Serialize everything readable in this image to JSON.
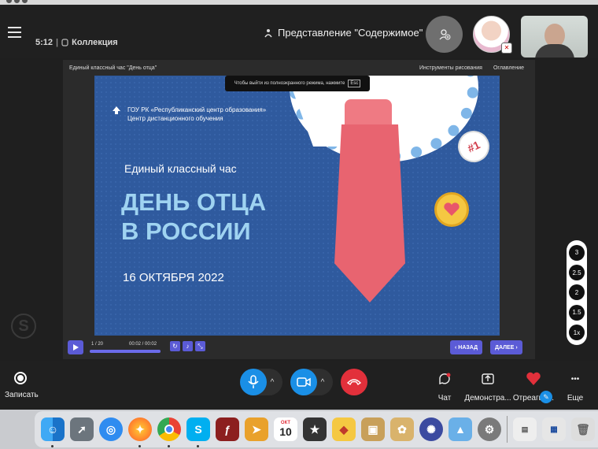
{
  "topbar": {
    "time": "5:12",
    "collection_label": "Коллекция",
    "view_label": "Представление \"Содержимое\""
  },
  "stage": {
    "title": "Единый классный час \"День отца\"",
    "tools_label": "Инструменты рисования",
    "toc_label": "Оглавление",
    "fullscreen_note": "Чтобы выйти из полноэкранного режима, нажмите",
    "fullscreen_key": "Esc"
  },
  "slide": {
    "org_line1": "ГОУ РК «Республиканский центр образования»",
    "org_line2": "Центр дистанционного обучения",
    "subtitle": "Единый классный час",
    "title_line1": "ДЕНЬ ОТЦА",
    "title_line2": "В РОССИИ",
    "date": "16 ОКТЯБРЯ 2022",
    "badge": "#1"
  },
  "player": {
    "position": "1 / 20",
    "time": "00:02 / 00:02",
    "progress_fraction": 1.0,
    "back_label": "НАЗАД",
    "next_label": "ДАЛЕЕ"
  },
  "speeds": [
    "3",
    "2.5",
    "2",
    "1.5",
    "1x"
  ],
  "bottombar": {
    "record_label": "Записать",
    "chat_label": "Чат",
    "share_label": "Демонстра...",
    "react_label": "Отреагир...",
    "more_label": "Еще"
  },
  "dock": {
    "calendar_month": "ОКТ",
    "calendar_day": "10"
  },
  "colors": {
    "accent": "#5b5bd6",
    "call_blue": "#1a8fe6",
    "hangup_red": "#e2303b",
    "slide_bg": "#2f5a9e"
  }
}
